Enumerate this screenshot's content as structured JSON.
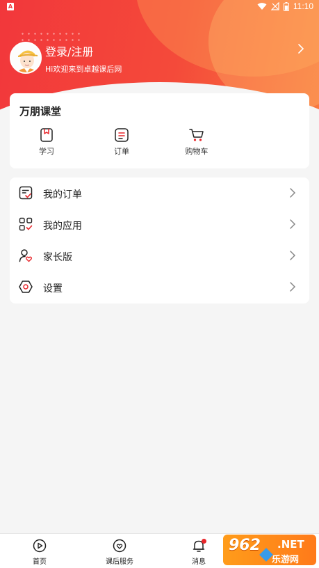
{
  "status_bar": {
    "left_badge": "A",
    "time": "11:10"
  },
  "header": {
    "title": "登录/注册",
    "subtitle": "Hi欢迎来到卓越课后网"
  },
  "classroom": {
    "title": "万朋课堂",
    "items": [
      {
        "label": "学习",
        "icon": "book-icon"
      },
      {
        "label": "订单",
        "icon": "order-list-icon"
      },
      {
        "label": "购物车",
        "icon": "cart-icon"
      }
    ]
  },
  "menu": {
    "items": [
      {
        "label": "我的订单",
        "icon": "order-check-icon"
      },
      {
        "label": "我的应用",
        "icon": "apps-grid-icon"
      },
      {
        "label": "家长版",
        "icon": "parent-heart-icon"
      },
      {
        "label": "设置",
        "icon": "hexagon-settings-icon"
      }
    ]
  },
  "bottom_nav": {
    "items": [
      {
        "label": "首页",
        "icon": "home-play-icon"
      },
      {
        "label": "课后服务",
        "icon": "service-heart-icon"
      },
      {
        "label": "消息",
        "icon": "bell-icon",
        "has_badge": true
      }
    ]
  },
  "watermark": {
    "number": "962",
    "domain": ".NET",
    "text": "乐游网"
  },
  "colors": {
    "accent": "#f2373b",
    "badge": "#e8262b",
    "background": "#f5f5f5"
  }
}
